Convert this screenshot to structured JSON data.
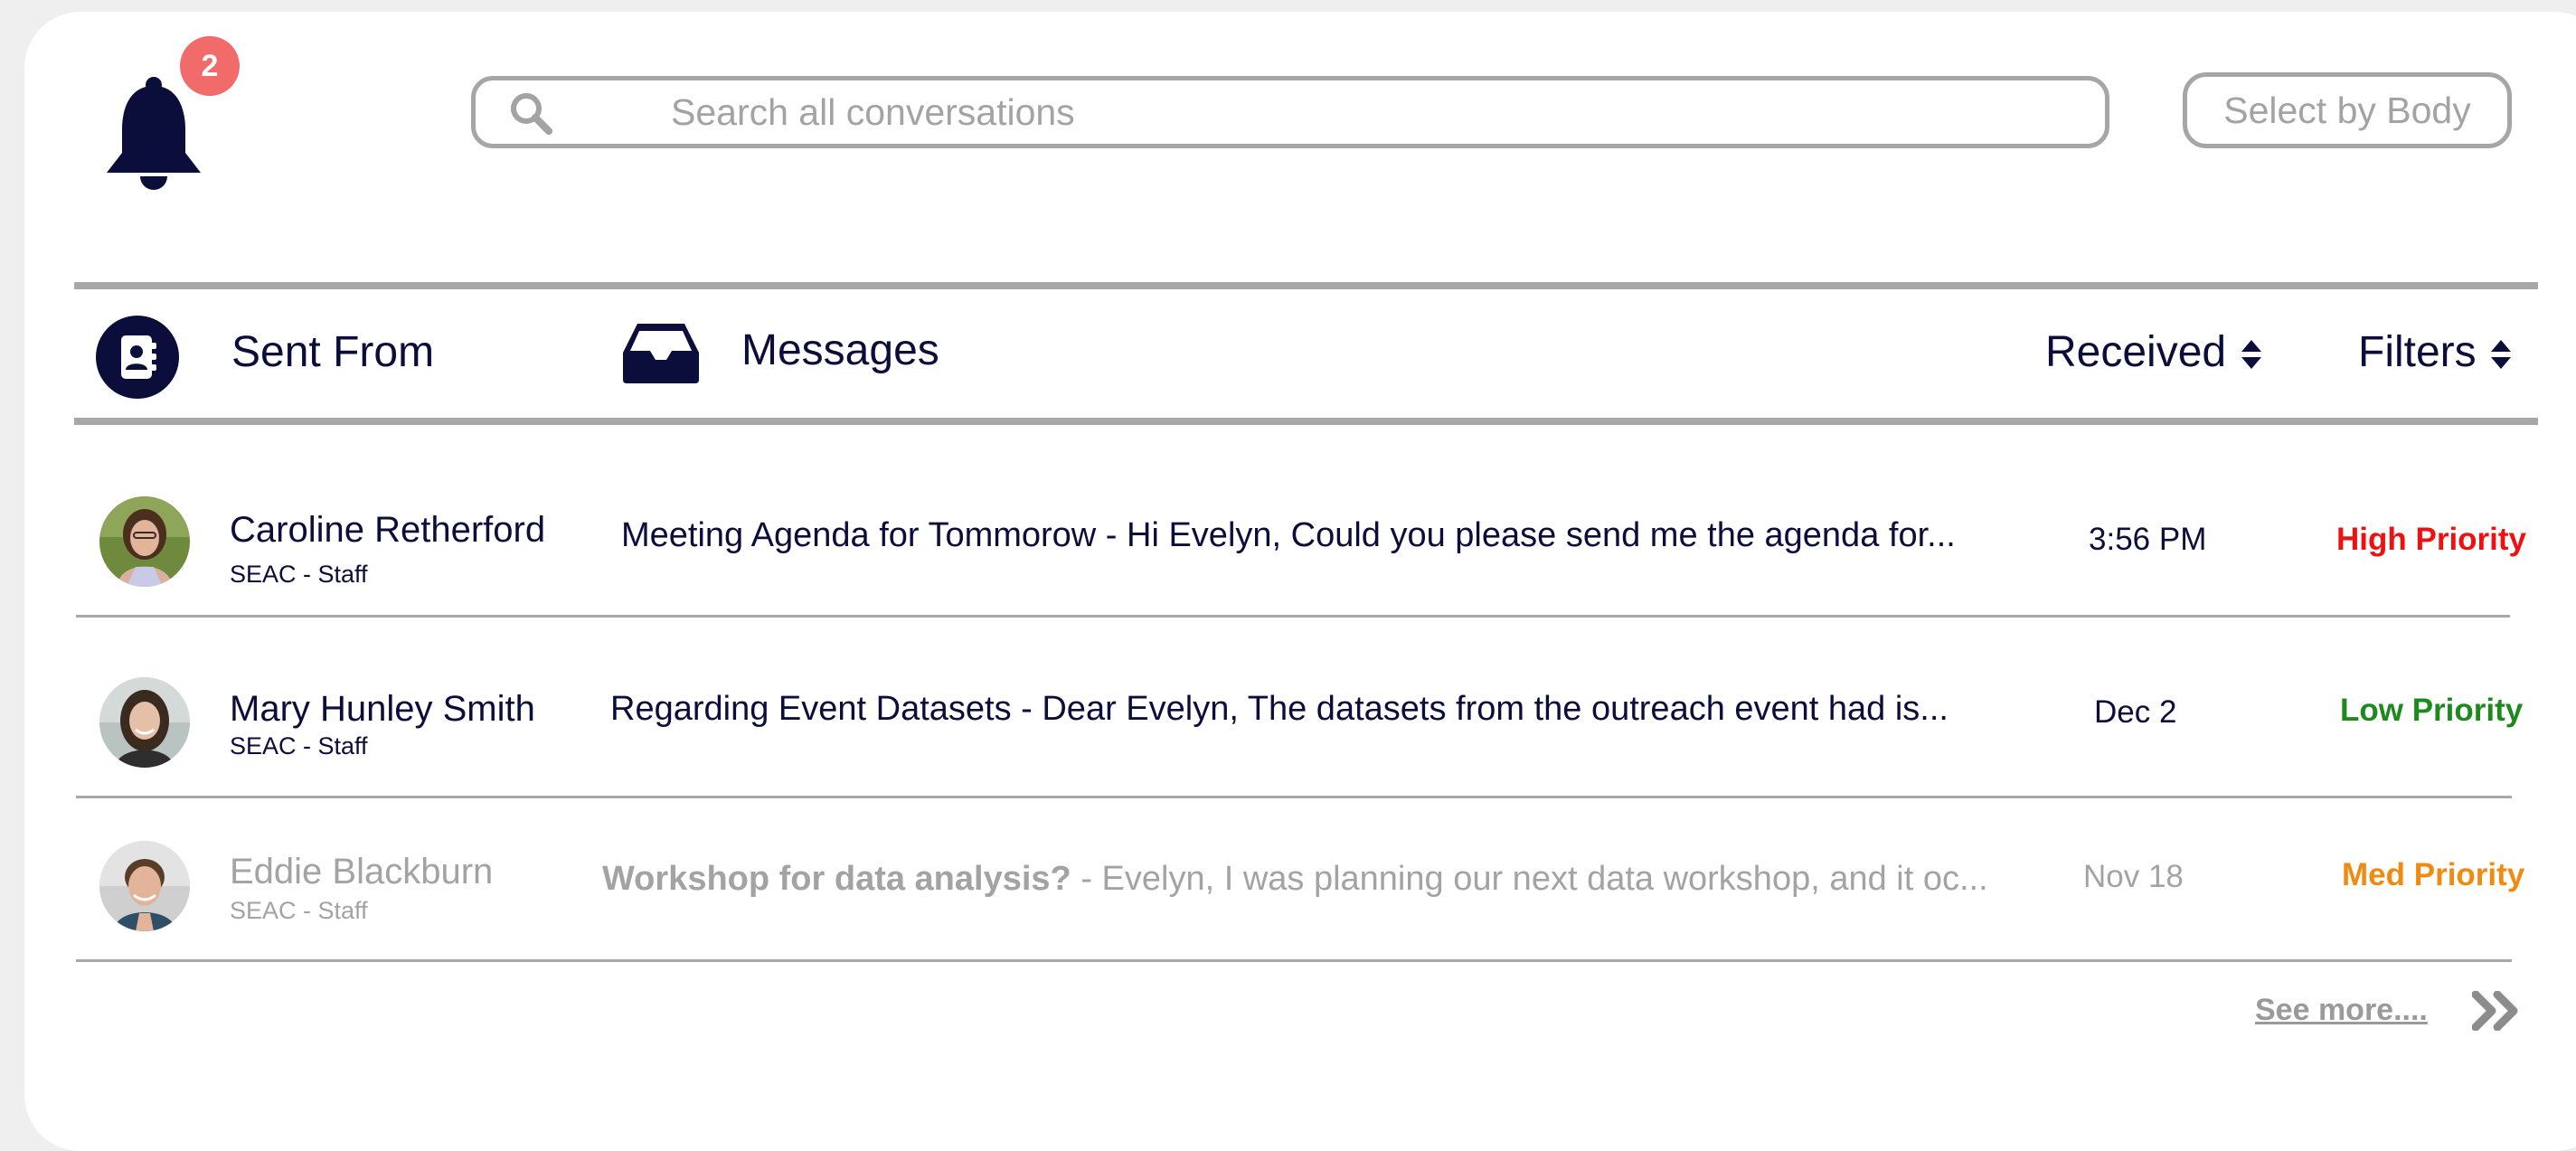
{
  "notifications": {
    "count": "2"
  },
  "search": {
    "placeholder": "Search all conversations"
  },
  "toolbar": {
    "select_label": "Select by Body"
  },
  "header": {
    "sent_from": "Sent From",
    "messages": "Messages",
    "received": "Received",
    "filters": "Filters"
  },
  "rows": [
    {
      "name": "Caroline Retherford",
      "org": "SEAC - Staff",
      "subject": "Meeting Agenda for Tommorow",
      "preview": " - Hi Evelyn, Could you please send me the agenda for...",
      "time": "3:56 PM",
      "priority": "High Priority",
      "priority_color": "#ee1111",
      "read": false
    },
    {
      "name": "Mary Hunley Smith",
      "org": "SEAC - Staff",
      "subject": "Regarding Event Datasets",
      "preview": " - Dear Evelyn, The datasets from the outreach event had is...",
      "time": "Dec 2",
      "priority": "Low Priority",
      "priority_color": "#1e8a1e",
      "read": false
    },
    {
      "name": "Eddie Blackburn",
      "org": "SEAC - Staff",
      "subject": "Workshop for data analysis?",
      "preview": " - Evelyn, I was planning our next data workshop, and it oc...",
      "time": "Nov 18",
      "priority": "Med Priority",
      "priority_color": "#f08a10",
      "read": true
    }
  ],
  "footer": {
    "see_more": "See more...."
  },
  "colors": {
    "navy": "#0b0e3a",
    "badge": "#f26b6b",
    "border_gray": "#a8a8a8",
    "muted_text": "#a3a3a3"
  }
}
